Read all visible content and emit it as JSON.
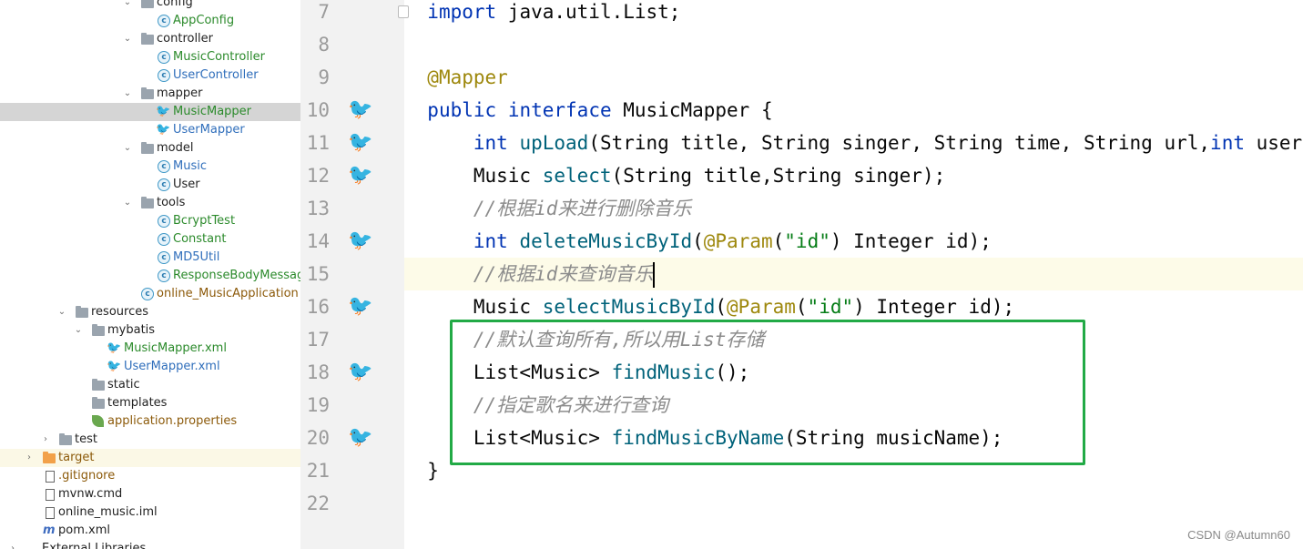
{
  "project_tree": {
    "items": [
      {
        "label": "config",
        "kind": "folder"
      },
      {
        "label": "AppConfig",
        "kind": "class"
      },
      {
        "label": "controller",
        "kind": "folder"
      },
      {
        "label": "MusicController",
        "kind": "class"
      },
      {
        "label": "UserController",
        "kind": "class"
      },
      {
        "label": "mapper",
        "kind": "folder"
      },
      {
        "label": "MusicMapper",
        "kind": "mapper"
      },
      {
        "label": "UserMapper",
        "kind": "mapper"
      },
      {
        "label": "model",
        "kind": "folder"
      },
      {
        "label": "Music",
        "kind": "class"
      },
      {
        "label": "User",
        "kind": "class"
      },
      {
        "label": "tools",
        "kind": "folder"
      },
      {
        "label": "BcryptTest",
        "kind": "class"
      },
      {
        "label": "Constant",
        "kind": "class"
      },
      {
        "label": "MD5Util",
        "kind": "class"
      },
      {
        "label": "ResponseBodyMessage",
        "kind": "class"
      },
      {
        "label": "online_MusicApplication",
        "kind": "class"
      },
      {
        "label": "resources",
        "kind": "folder"
      },
      {
        "label": "mybatis",
        "kind": "folder"
      },
      {
        "label": "MusicMapper.xml",
        "kind": "xml"
      },
      {
        "label": "UserMapper.xml",
        "kind": "xml"
      },
      {
        "label": "static",
        "kind": "folder"
      },
      {
        "label": "templates",
        "kind": "folder"
      },
      {
        "label": "application.properties",
        "kind": "properties"
      },
      {
        "label": "test",
        "kind": "folder"
      },
      {
        "label": "target",
        "kind": "folder"
      },
      {
        "label": ".gitignore",
        "kind": "file"
      },
      {
        "label": "mvnw.cmd",
        "kind": "file"
      },
      {
        "label": "online_music.iml",
        "kind": "file"
      },
      {
        "label": "pom.xml",
        "kind": "maven"
      },
      {
        "label": "External Libraries",
        "kind": "library"
      }
    ]
  },
  "editor": {
    "line_numbers": [
      "7",
      "8",
      "9",
      "10",
      "11",
      "12",
      "13",
      "14",
      "15",
      "16",
      "17",
      "18",
      "19",
      "20",
      "21",
      "22"
    ],
    "code": {
      "l7_kw": "import",
      "l7_rest": " java.util.List;",
      "l9_ann": "@Mapper",
      "l10_kw1": "public",
      "l10_kw2": "interface",
      "l10_rest": " MusicMapper {",
      "l11_kw": "int",
      "l11_fn": "upLoad",
      "l11_mid": "(String title, String singer, String time, String url,",
      "l11_kw2": "int",
      "l11_tail": " user",
      "l12_type": "Music ",
      "l12_fn": "select",
      "l12_rest": "(String title,String singer);",
      "l13_cmt": "//根据id来进行删除音乐",
      "l14_kw": "int",
      "l14_fn": "deleteMusicById",
      "l14_p1": "(",
      "l14_ann": "@Param",
      "l14_p2": "(",
      "l14_str": "\"id\"",
      "l14_rest": ") Integer id);",
      "l15_cmt": "//根据id来查询音乐",
      "l16_type": "Music ",
      "l16_fn": "selectMusicById",
      "l16_p1": "(",
      "l16_ann": "@Param",
      "l16_p2": "(",
      "l16_str": "\"id\"",
      "l16_rest": ") Integer id);",
      "l17_cmt": "//默认查询所有,所以用List存储",
      "l18_type": "List<Music> ",
      "l18_fn": "findMusic",
      "l18_rest": "();",
      "l19_cmt": "//指定歌名来进行查询",
      "l20_type": "List<Music> ",
      "l20_fn": "findMusicByName",
      "l20_rest": "(String musicName);",
      "l21": "}"
    },
    "highlight_color": "#22aa46"
  },
  "watermark": "CSDN @Autumn60"
}
